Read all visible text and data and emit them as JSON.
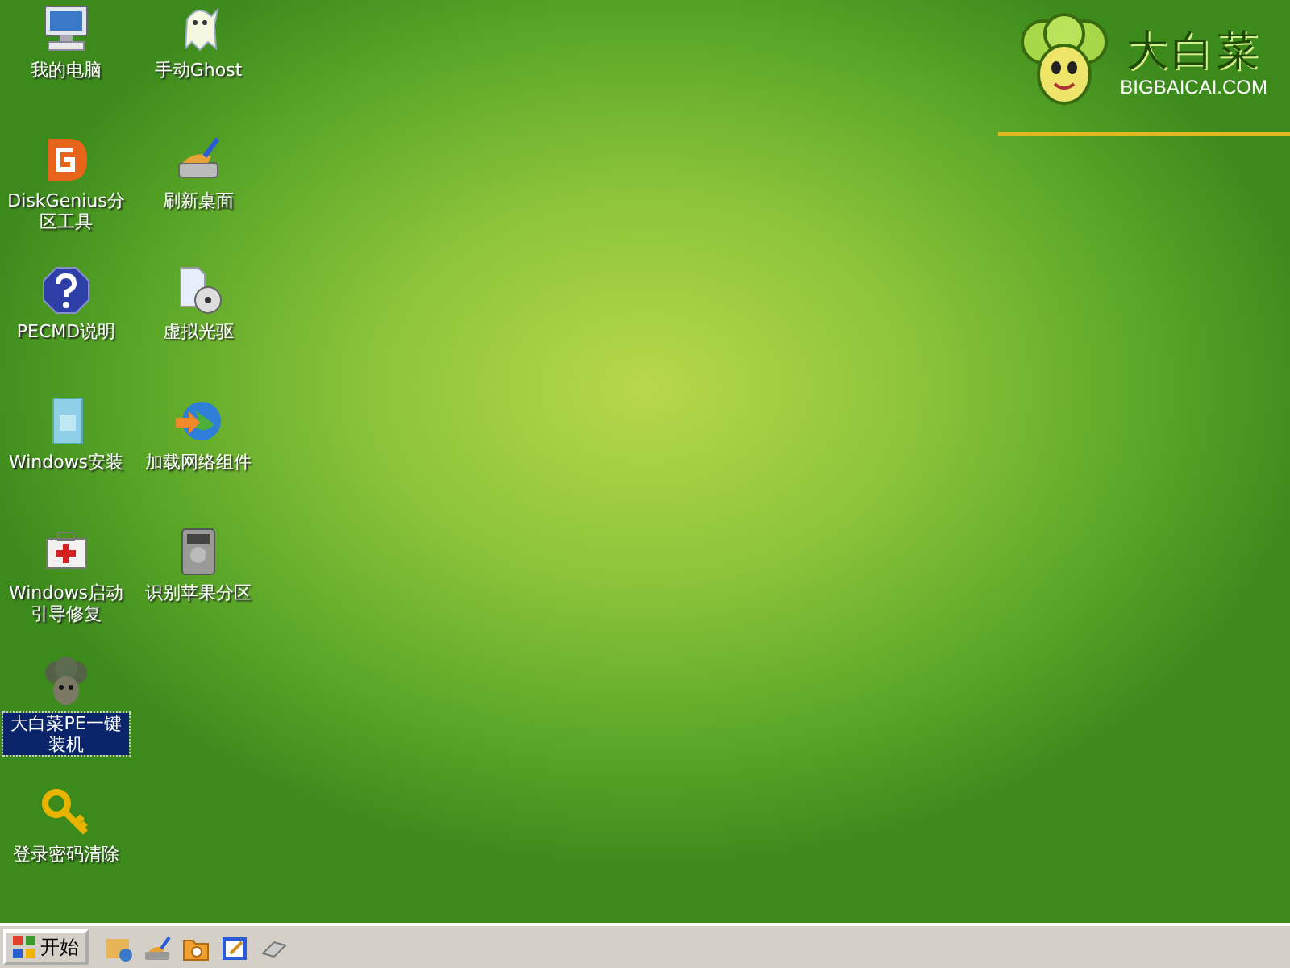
{
  "desktop_icon_rows": [
    [
      {
        "label": "我的电脑",
        "selected": false
      },
      {
        "label": "手动Ghost",
        "selected": false
      }
    ],
    [
      {
        "label": "DiskGenius分区工具",
        "selected": false
      },
      {
        "label": "刷新桌面",
        "selected": false
      }
    ],
    [
      {
        "label": "PECMD说明",
        "selected": false
      },
      {
        "label": "虚拟光驱",
        "selected": false
      }
    ],
    [
      {
        "label": "Windows安装",
        "selected": false
      },
      {
        "label": "加载网络组件",
        "selected": false
      }
    ],
    [
      {
        "label": "Windows启动引导修复",
        "selected": false
      },
      {
        "label": "识别苹果分区",
        "selected": false
      }
    ],
    [
      {
        "label": "大白菜PE一键装机",
        "selected": true
      }
    ],
    [
      {
        "label": "登录密码清除",
        "selected": false
      }
    ]
  ],
  "logo": {
    "title": "大白菜",
    "url": "BIGBAICAI.COM"
  },
  "taskbar": {
    "start_button": "开始"
  }
}
